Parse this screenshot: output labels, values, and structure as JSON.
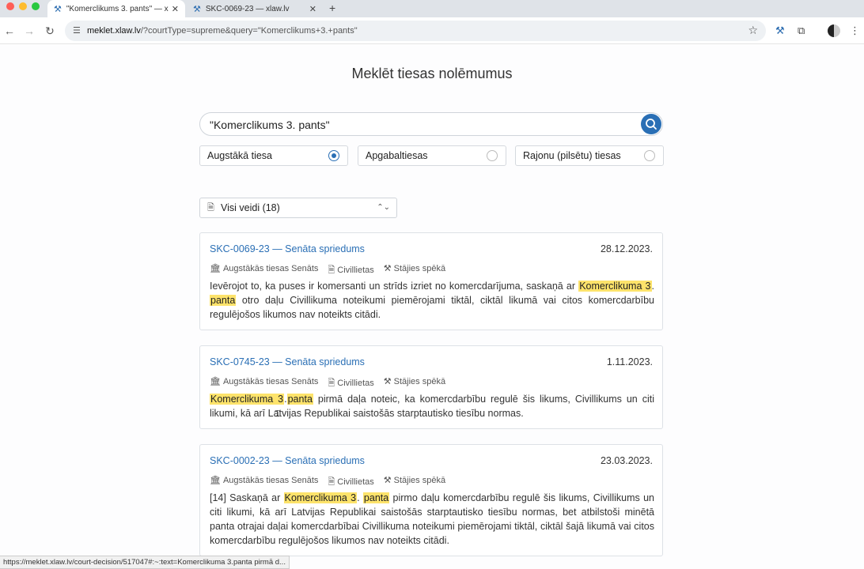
{
  "browser": {
    "tabs": [
      {
        "title": "\"Komerclikums 3. pants\" — x",
        "active": true
      },
      {
        "title": "SKC-0069-23 — xlaw.lv",
        "active": false
      }
    ],
    "url_host": "meklet.xlaw.lv",
    "url_rest": "/?courtType=supreme&query=\"Komerclikums+3.+pants\"",
    "status_url": "https://meklet.xlaw.lv/court-decision/517047#:~:text=Komerclikuma 3.panta pirmā d..."
  },
  "page": {
    "title": "Meklēt tiesas nolēmumus",
    "search_value": "\"Komerclikums 3. pants\"",
    "court_options": [
      {
        "label": "Augstākā tiesa",
        "selected": true
      },
      {
        "label": "Apgabaltiesas",
        "selected": false
      },
      {
        "label": "Rajonu (pilsētu) tiesas",
        "selected": false
      }
    ],
    "type_filter": "Visi veidi (18)"
  },
  "results": [
    {
      "title": "SKC-0069-23 — Senāta spriedums",
      "date": "28.12.2023.",
      "court": "Augstākās tiesas Senāts",
      "category": "Civillietas",
      "status": "Stājies spēkā",
      "excerpt_parts": [
        "Ievērojot to, ka puses ir komersanti un strīds izriet no komercdarījuma, saskaņā ar ",
        "Komerclikuma 3",
        ". ",
        "panta",
        " otro daļu Civillikuma noteikumi piemērojami tiktāl, ciktāl likumā vai citos komercdarbību regulējošos likumos nav noteikts citādi."
      ]
    },
    {
      "title": "SKC-0745-23 — Senāta spriedums",
      "date": "1.11.2023.",
      "court": "Augstākās tiesas Senāts",
      "category": "Civillietas",
      "status": "Stājies spēkā",
      "excerpt_parts": [
        "",
        "Komerclikuma 3",
        ".",
        "panta",
        " pirmā daļa noteic, ka komercdarbību regulē šis likums, Civillikums un citi likumi, kā arī Latvijas Republikai saistošās starptautisko tiesību normas."
      ]
    },
    {
      "title": "SKC-0002-23 — Senāta spriedums",
      "date": "23.03.2023.",
      "court": "Augstākās tiesas Senāts",
      "category": "Civillietas",
      "status": "Stājies spēkā",
      "excerpt_parts": [
        "[14] Saskaņā ar ",
        "Komerclikuma 3",
        ". ",
        "panta",
        " pirmo daļu komercdarbību regulē šis likums, Civillikums un citi likumi, kā arī Latvijas Republikai saistošās starptautisko tiesību normas, bet atbilstoši minētā panta otrajai daļai komercdarbībai Civillikuma noteikumi piemērojami tiktāl, ciktāl šajā likumā vai citos komercdarbību regulējošos likumos nav noteikts citādi."
      ]
    }
  ],
  "icons": {
    "gavel": "⚒",
    "building": "🏛",
    "document": "🗎",
    "hammer": "⚒",
    "search": "⌕"
  },
  "colors": {
    "accent": "#2a6fb5",
    "highlight": "#fde36b"
  }
}
